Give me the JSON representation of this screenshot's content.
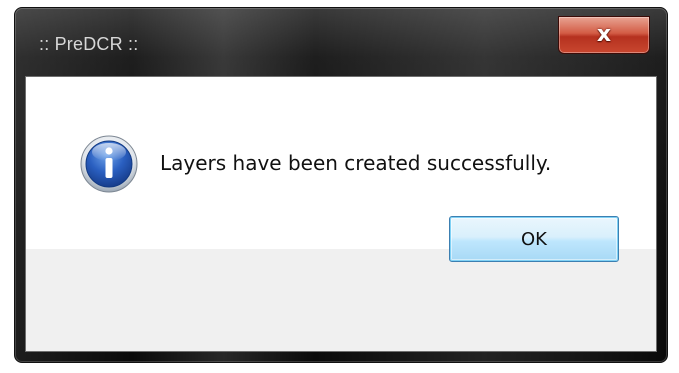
{
  "window": {
    "title": ":: PreDCR ::",
    "close_label": "x"
  },
  "dialog": {
    "icon": "info-icon",
    "message": "Layers have been created successfully.",
    "ok_label": "OK"
  },
  "colors": {
    "frame": "#101010",
    "close_button": "#c9472f",
    "footer": "#f0f0f0",
    "ok_button": "#bee6fd",
    "ok_border": "#3c7fb1",
    "icon_blue": "#1b4fa0"
  }
}
